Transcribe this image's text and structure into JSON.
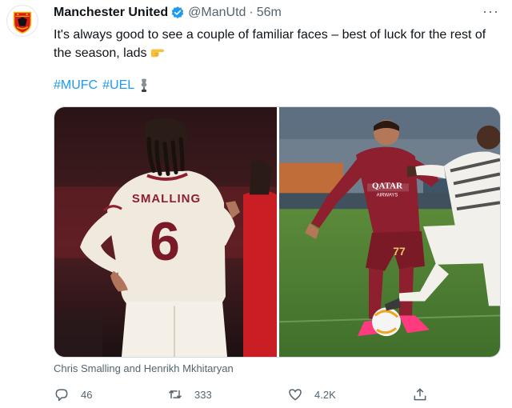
{
  "account": {
    "name": "Manchester United",
    "handle": "@ManUtd",
    "separator": "·",
    "time": "56m"
  },
  "more_label": "···",
  "tweet_text": "It's always good to see a couple of familiar faces – best of luck for the rest of the season, lads",
  "hashtags": [
    "#MUFC",
    "#UEL"
  ],
  "media": {
    "left_photo": {
      "shirt_name": "SMALLING",
      "shirt_number": "6"
    },
    "right_photo": {
      "sponsor_line1": "QATAR",
      "sponsor_line2": "AIRWAYS",
      "shorts_number": "77"
    },
    "caption": "Chris Smalling and Henrikh Mkhitaryan"
  },
  "actions": {
    "replies": "46",
    "retweets": "333",
    "likes": "4.2K"
  },
  "colors": {
    "link": "#1d9bf0",
    "secondary_text": "#536471",
    "primary_text": "#0f1419",
    "verified_badge": "#1d9bf0",
    "roma_red": "#8e1f2f",
    "united_white": "#f2f0ea"
  }
}
